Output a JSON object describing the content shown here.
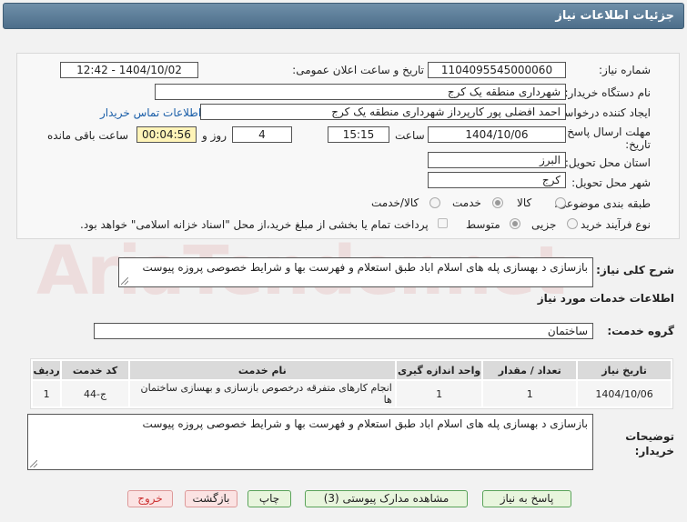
{
  "page": {
    "title": "جزئیات اطلاعات نیاز"
  },
  "fields": {
    "need_number_label": "شماره نیاز:",
    "need_number": "1104095545000060",
    "announce_label": "تاریخ و ساعت اعلان عمومی:",
    "announce_value": "1404/10/02 - 12:42",
    "buyer_label": "نام دستگاه خریدار:",
    "buyer_value": "شهرداری منطقه یک کرج",
    "creator_label": "ایجاد کننده درخواست:",
    "creator_value": "احمد افضلی پور کارپرداز شهرداری منطقه یک کرج",
    "contact_link": "اطلاعات تماس خریدار",
    "deadline_label_1": "مهلت ارسال پاسخ: تا",
    "deadline_label_2": "تاریخ:",
    "deadline_date": "1404/10/06",
    "time_label": "ساعت",
    "deadline_time": "15:15",
    "days_value": "4",
    "days_label": "روز و",
    "remaining_time": "00:04:56",
    "remaining_label": "ساعت باقی مانده",
    "province_label": "استان محل تحویل:",
    "province_value": "البرز",
    "city_label": "شهر محل تحویل:",
    "city_value": "کرج",
    "category_label": "طبقه بندی موضوعی:",
    "category_options": [
      "کالا",
      "خدمت",
      "کالا/خدمت"
    ],
    "category_selected": "خدمت",
    "process_label": "نوع فرآیند خرید :",
    "process_options": [
      "جزیی",
      "متوسط"
    ],
    "process_selected": "متوسط",
    "payment_note": "پرداخت تمام یا بخشی از مبلغ خرید،از محل \"اسناد خزانه اسلامی\" خواهد بود."
  },
  "description": {
    "label": "شرح کلی نیاز:",
    "value": "بازسازی د بهسازی پله های اسلام اباد طبق استعلام و فهرست بها و شرایط خصوصی پروزه  پیوست"
  },
  "services": {
    "section_title": "اطلاعات خدمات مورد نیاز",
    "group_label": "گروه خدمت:",
    "group_value": "ساختمان",
    "columns": [
      "ردیف",
      "کد خدمت",
      "نام خدمت",
      "واحد اندازه گیری",
      "تعداد / مقدار",
      "تاریخ نیاز"
    ],
    "rows": [
      [
        "1",
        "ج-44",
        "انجام کارهای متفرقه درخصوص بازسازی و بهسازی ساختمان ها",
        "1",
        "1",
        "1404/10/06"
      ]
    ]
  },
  "buyer_notes": {
    "label_1": "توضیحات",
    "label_2": "خریدار:",
    "value": "بازسازی د بهسازی پله های اسلام اباد طبق استعلام و فهرست بها و شرایط خصوصی پروزه  پیوست"
  },
  "buttons": {
    "reply": "پاسخ به نیاز",
    "attachments": "مشاهده مدارک پیوستی (3)",
    "print": "چاپ",
    "back": "بازگشت",
    "exit": "خروج"
  },
  "colors": {
    "header": "#5b7c98",
    "accent_link": "#1a5ea8",
    "button_green": "#e8f5dd"
  }
}
